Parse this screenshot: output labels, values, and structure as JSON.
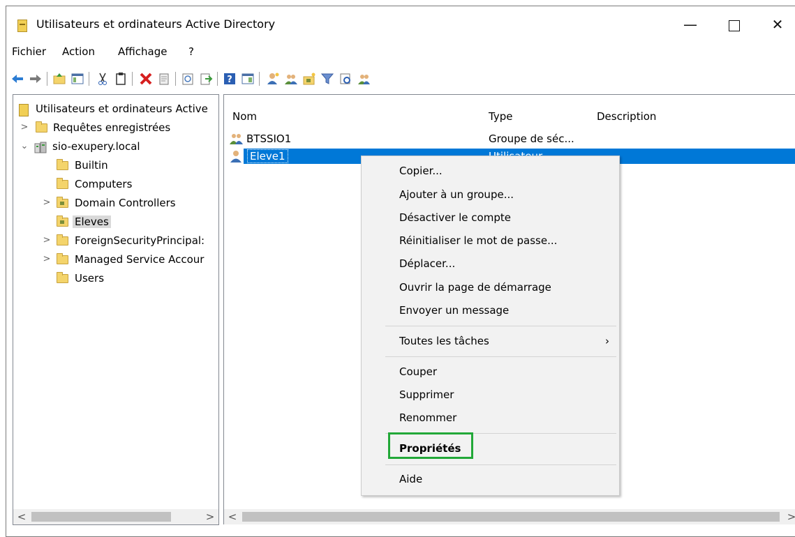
{
  "window": {
    "title": "Utilisateurs et ordinateurs Active Directory",
    "controls": {
      "minimize": "—",
      "maximize": "",
      "close": "✕"
    }
  },
  "menu": {
    "items": [
      "Fichier",
      "Action",
      "Affichage",
      "?"
    ]
  },
  "toolbar": {
    "icons": [
      "back-arrow-icon",
      "forward-arrow-icon",
      "up-folder-icon",
      "show-hide-console-tree-icon",
      "cut-icon",
      "paste-icon",
      "delete-icon",
      "properties-icon",
      "refresh-icon",
      "export-list-icon",
      "help-icon",
      "show-action-pane-icon",
      "new-user-icon",
      "new-group-icon",
      "new-ou-icon",
      "filter-icon",
      "find-icon",
      "add-to-group-icon"
    ]
  },
  "tree": {
    "root": "Utilisateurs et ordinateurs Active",
    "items": [
      {
        "label": "Requêtes enregistrées"
      },
      {
        "label": "sio-exupery.local"
      },
      {
        "label": "Builtin"
      },
      {
        "label": "Computers"
      },
      {
        "label": "Domain Controllers"
      },
      {
        "label": "Eleves"
      },
      {
        "label": "ForeignSecurityPrincipal:"
      },
      {
        "label": "Managed Service Accour"
      },
      {
        "label": "Users"
      }
    ]
  },
  "list": {
    "columns": [
      "Nom",
      "Type",
      "Description"
    ],
    "rows": [
      {
        "name": "BTSSIO1",
        "type": "Groupe de séc..."
      },
      {
        "name": "Eleve1",
        "type": "Utilisateur"
      }
    ]
  },
  "context_menu": {
    "items": [
      "Copier...",
      "Ajouter à un groupe...",
      "Désactiver le compte",
      "Réinitialiser le mot de passe...",
      "Déplacer...",
      "Ouvrir la page de démarrage",
      "Envoyer un message",
      "Toutes les tâches",
      "Couper",
      "Supprimer",
      "Renommer",
      "Propriétés",
      "Aide"
    ],
    "submenu_arrow": "›",
    "highlight_color": "#22a838"
  },
  "scroll": {
    "left": "<",
    "right": ">"
  }
}
